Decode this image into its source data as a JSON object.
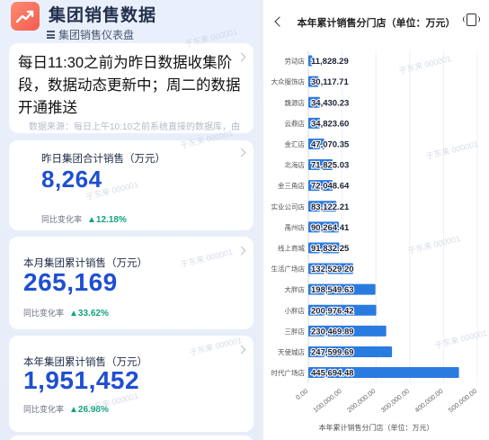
{
  "left": {
    "app_title": "集团销售数据",
    "subtitle": "集团销售仪表盘",
    "notice": {
      "headline": "每日11:30之前为昨日数据收集阶段，数据动态更新中；周二的数据开通推送",
      "detail": "数据来源：每日上午10:10之前系统直接的数据库，由"
    },
    "metrics": [
      {
        "label": "昨日集团合计销售（万元）",
        "value": "8,264",
        "cmp_label": "同比变化率",
        "cmp_value": "12.18%"
      },
      {
        "label": "本月集团累计销售（万元）",
        "value": "265,169",
        "cmp_label": "同比变化率",
        "cmp_value": "33.62%"
      },
      {
        "label": "本年集团累计销售（万元）",
        "value": "1,951,452",
        "cmp_label": "同比变化率",
        "cmp_value": "26.98%"
      }
    ],
    "watermark": "于东来 000001"
  },
  "right": {
    "title": "本年累计销售分门店（单位：万元）"
  },
  "colors": {
    "accent": "#1f4fd1",
    "bar": "#2a7be0",
    "positive": "#10a37f"
  },
  "chart_data": {
    "type": "bar",
    "orientation": "horizontal",
    "title": "本年累计销售分门店（单位：万元）",
    "xlabel": "本年累计销售分门店（单位：万元）",
    "ylabel": "",
    "xlim": [
      0,
      500000
    ],
    "x_ticks": [
      "0.00",
      "100,000.00",
      "200,000.00",
      "300,000.00",
      "400,000.00",
      "500,000.00"
    ],
    "grid": true,
    "categories": [
      "劳动店",
      "大众服饰店",
      "魏源店",
      "云鼎店",
      "金汇店",
      "北海店",
      "金三角店",
      "实业公司店",
      "禹州店",
      "线上商城",
      "生活广场店",
      "大胖店",
      "小胖店",
      "三胖店",
      "天使城店",
      "时代广场店"
    ],
    "values": [
      11828.29,
      30117.71,
      34430.23,
      34823.6,
      47070.35,
      71825.03,
      72048.64,
      83122.21,
      90264.41,
      91832.25,
      132529.2,
      198549.63,
      200976.42,
      230469.89,
      247599.69,
      445694.48
    ],
    "value_labels": [
      "11,828.29",
      "30,117.71",
      "34,430.23",
      "34,823.60",
      "47,070.35",
      "71,825.03",
      "72,048.64",
      "83,122.21",
      "90,264.41",
      "91,832.25",
      "132,529.20",
      "198,549.63",
      "200,976.42",
      "230,469.89",
      "247,599.69",
      "445,694.48"
    ]
  }
}
